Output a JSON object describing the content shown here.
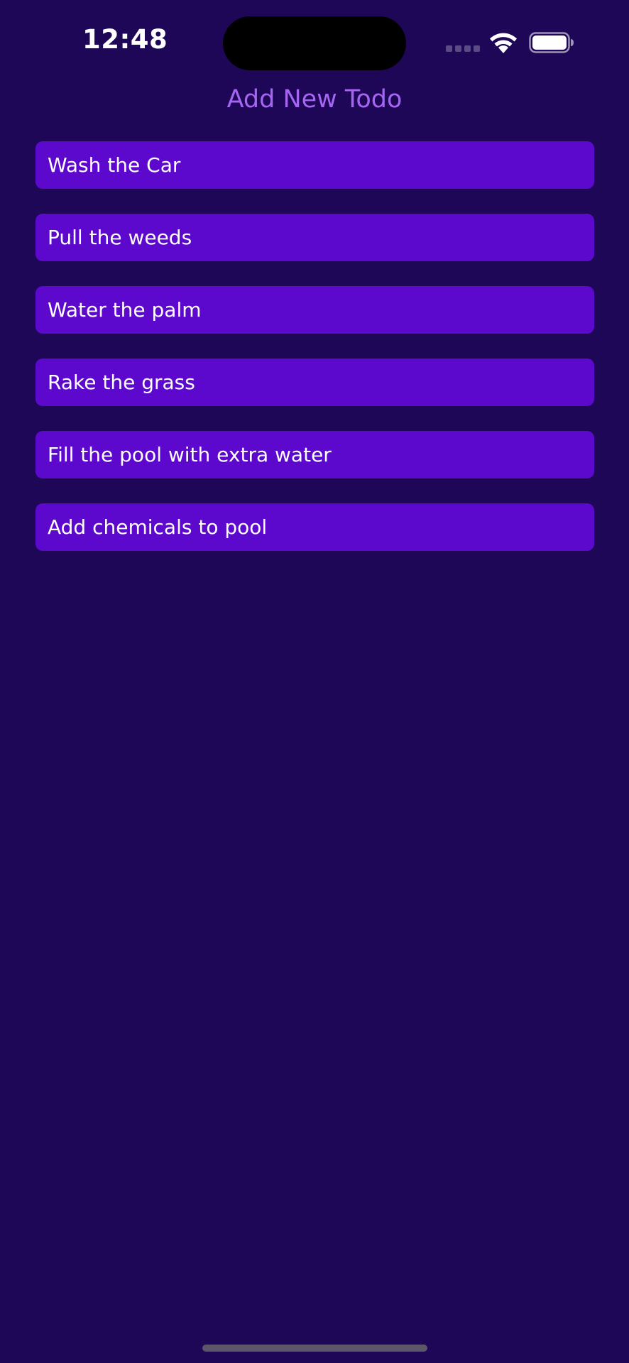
{
  "status_bar": {
    "time": "12:48",
    "signal_icon": "cellular-signal-icon",
    "wifi_icon": "wifi-icon",
    "battery_icon": "battery-icon"
  },
  "header": {
    "add_label": "Add New Todo"
  },
  "todos": [
    {
      "label": "Wash the Car"
    },
    {
      "label": "Pull the weeds"
    },
    {
      "label": "Water the palm"
    },
    {
      "label": "Rake the grass"
    },
    {
      "label": "Fill the pool with extra water"
    },
    {
      "label": "Add chemicals to pool"
    }
  ],
  "colors": {
    "background": "#1d0756",
    "item_background": "#5d08cd",
    "accent_text": "#a665f2",
    "item_text": "#ffffff"
  }
}
